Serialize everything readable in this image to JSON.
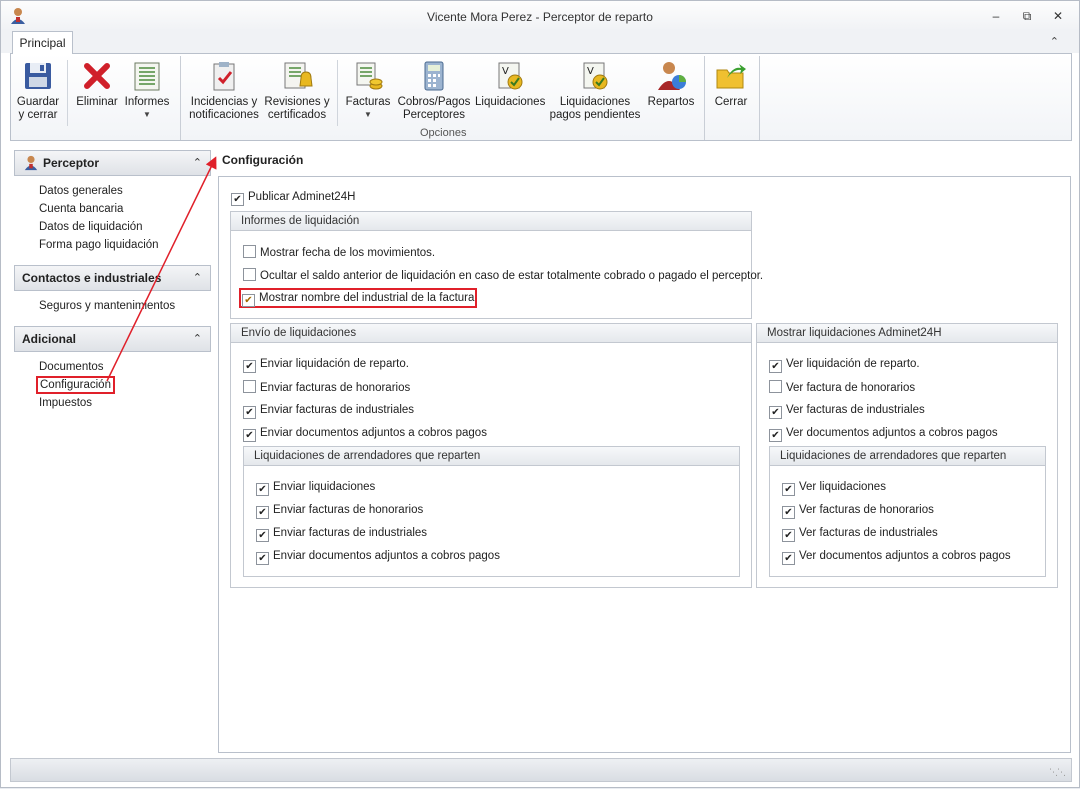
{
  "window": {
    "title": "Vicente Mora Perez - Perceptor de reparto"
  },
  "ribbon": {
    "tab": "Principal",
    "buttons": {
      "guardar": "Guardar\ny cerrar",
      "eliminar": "Eliminar",
      "informes": "Informes",
      "incidencias": "Incidencias y\nnotificaciones",
      "revisiones": "Revisiones y\ncertificados",
      "facturas": "Facturas",
      "cobros": "Cobros/Pagos\nPerceptores",
      "liquidaciones": "Liquidaciones",
      "liq_pendientes": "Liquidaciones\npagos pendientes",
      "repartos": "Repartos",
      "cerrar": "Cerrar"
    },
    "group_label": "Opciones"
  },
  "nav": {
    "sections": [
      {
        "title": "Perceptor",
        "items": [
          "Datos generales",
          "Cuenta bancaria",
          "Datos de liquidación",
          "Forma pago liquidación"
        ]
      },
      {
        "title": "Contactos e industriales",
        "items": [
          "Seguros y mantenimientos"
        ]
      },
      {
        "title": "Adicional",
        "items": [
          "Documentos",
          "Configuración",
          "Impuestos"
        ]
      }
    ]
  },
  "content": {
    "title": "Configuración",
    "publicar": {
      "label": "Publicar Adminet24H",
      "checked": true
    },
    "informes": {
      "title": "Informes de liquidación",
      "items": [
        {
          "label": "Mostrar fecha de los movimientos.",
          "checked": false
        },
        {
          "label": "Ocultar el saldo anterior de liquidación en caso de estar totalmente cobrado o pagado el perceptor.",
          "checked": false
        },
        {
          "label": "Mostrar nombre del industrial de la factura",
          "checked": true
        }
      ]
    },
    "envio": {
      "title": "Envío de liquidaciones",
      "items": [
        {
          "label": "Enviar liquidación de reparto.",
          "checked": true
        },
        {
          "label": "Enviar facturas de honorarios",
          "checked": false
        },
        {
          "label": "Enviar facturas de industriales",
          "checked": true
        },
        {
          "label": "Enviar documentos adjuntos a cobros pagos",
          "checked": true
        }
      ],
      "sub": {
        "title": "Liquidaciones de arrendadores que reparten",
        "items": [
          {
            "label": "Enviar liquidaciones",
            "checked": true
          },
          {
            "label": "Enviar facturas de honorarios",
            "checked": true
          },
          {
            "label": "Enviar facturas de industriales",
            "checked": true
          },
          {
            "label": "Enviar documentos adjuntos a cobros pagos",
            "checked": true
          }
        ]
      }
    },
    "mostrar": {
      "title": "Mostrar liquidaciones Adminet24H",
      "items": [
        {
          "label": "Ver liquidación de reparto.",
          "checked": true
        },
        {
          "label": "Ver factura de honorarios",
          "checked": false
        },
        {
          "label": "Ver facturas de industriales",
          "checked": true
        },
        {
          "label": "Ver documentos adjuntos a cobros pagos",
          "checked": true
        }
      ],
      "sub": {
        "title": "Liquidaciones de arrendadores que reparten",
        "items": [
          {
            "label": "Ver liquidaciones",
            "checked": true
          },
          {
            "label": "Ver facturas de honorarios",
            "checked": true
          },
          {
            "label": "Ver facturas de industriales",
            "checked": true
          },
          {
            "label": "Ver documentos adjuntos a cobros pagos",
            "checked": true
          }
        ]
      }
    }
  },
  "colors": {
    "highlight": "#e0202a",
    "accent": "#3b7dd8"
  }
}
